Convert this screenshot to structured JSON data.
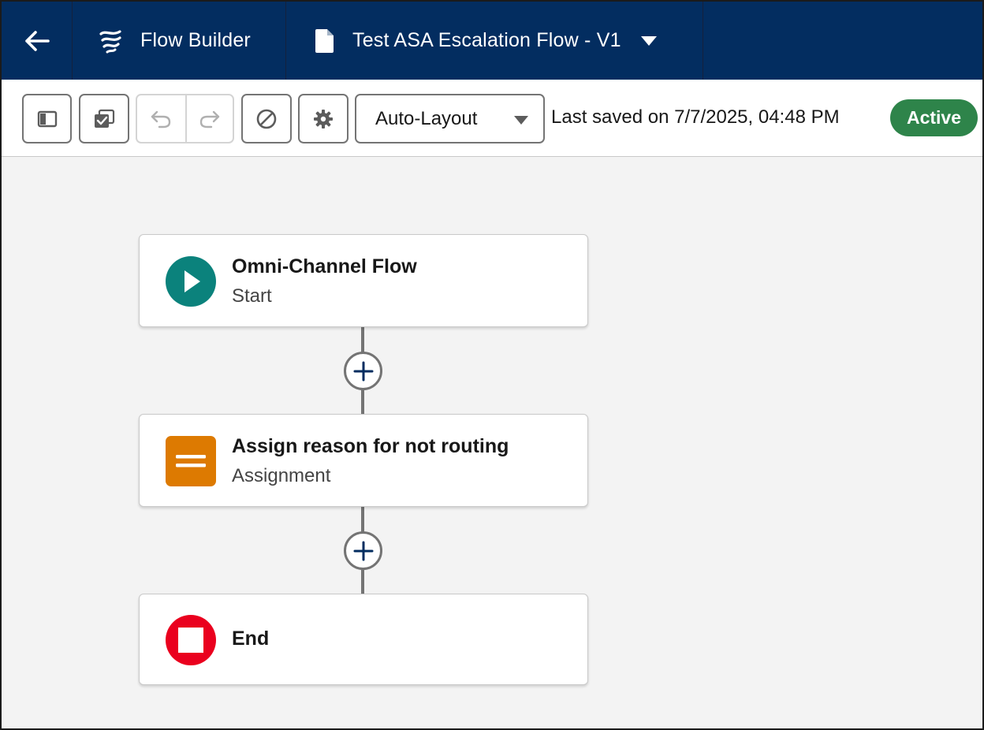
{
  "header": {
    "back_icon": "arrow-left-icon",
    "app_name": "Flow Builder",
    "app_icon": "flow-builder-logo-icon",
    "flow_name": "Test ASA Escalation Flow - V1",
    "flow_icon": "document-icon",
    "background_color": "#032d60"
  },
  "toolbar": {
    "buttons": [
      {
        "name": "toggle-panel",
        "icon": "panel-icon"
      },
      {
        "name": "check-flow",
        "icon": "checklist-icon"
      },
      {
        "name": "undo",
        "icon": "undo-icon",
        "disabled": true
      },
      {
        "name": "redo",
        "icon": "redo-icon",
        "disabled": true
      },
      {
        "name": "deactivate",
        "icon": "ban-icon"
      },
      {
        "name": "settings",
        "icon": "gear-icon"
      }
    ],
    "layout_mode": "Auto-Layout",
    "last_saved": "Last saved on 7/7/2025, 04:48 PM",
    "status": "Active",
    "status_color": "#2e844a"
  },
  "canvas": {
    "nodes": [
      {
        "title": "Omni-Channel Flow",
        "subtitle": "Start",
        "type": "start",
        "icon": "play-icon",
        "color": "#0b827c"
      },
      {
        "title": "Assign reason for not routing",
        "subtitle": "Assignment",
        "type": "assignment",
        "icon": "equals-icon",
        "color": "#dd7a01"
      },
      {
        "title": "End",
        "subtitle": "",
        "type": "end",
        "icon": "stop-icon",
        "color": "#ea001e"
      }
    ],
    "add_element_icon": "plus-icon"
  }
}
